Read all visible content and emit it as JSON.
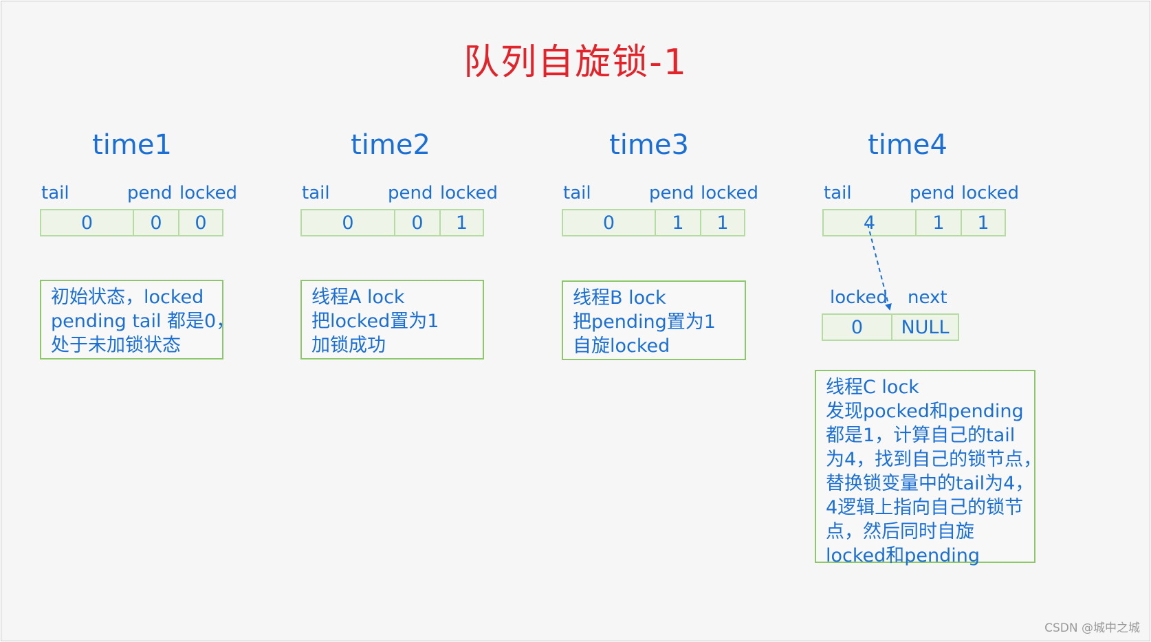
{
  "title": "队列自旋锁-1",
  "columns": [
    {
      "time": "time1",
      "labels": {
        "tail": "tail",
        "pend": "pend",
        "locked": "locked"
      },
      "values": {
        "tail": "0",
        "pend": "0",
        "locked": "0"
      },
      "note": [
        "初始状态，locked",
        "pending tail 都是0，",
        "处于未加锁状态"
      ]
    },
    {
      "time": "time2",
      "labels": {
        "tail": "tail",
        "pend": "pend",
        "locked": "locked"
      },
      "values": {
        "tail": "0",
        "pend": "0",
        "locked": "1"
      },
      "note": [
        "线程A lock",
        "把locked置为1",
        "加锁成功"
      ]
    },
    {
      "time": "time3",
      "labels": {
        "tail": "tail",
        "pend": "pend",
        "locked": "locked"
      },
      "values": {
        "tail": "0",
        "pend": "1",
        "locked": "1"
      },
      "note": [
        "线程B lock",
        "把pending置为1",
        "自旋locked"
      ]
    },
    {
      "time": "time4",
      "labels": {
        "tail": "tail",
        "pend": "pend",
        "locked": "locked"
      },
      "values": {
        "tail": "4",
        "pend": "1",
        "locked": "1"
      },
      "node": {
        "labels": {
          "locked": "locked",
          "next": "next"
        },
        "values": {
          "locked": "0",
          "next": "NULL"
        }
      },
      "note": [
        "线程C lock",
        "发现pocked和pending",
        "都是1，计算自己的tail",
        "为4，找到自己的锁节点，",
        "替换锁变量中的tail为4，",
        "4逻辑上指向自己的锁节",
        "点，然后同时自旋",
        "locked和pending"
      ]
    }
  ],
  "watermark": "CSDN @城中之城",
  "colors": {
    "title": "#e2232a",
    "text": "#1a6fd6",
    "cell_border": "#b4dba0",
    "note_border": "#8cc86a"
  }
}
